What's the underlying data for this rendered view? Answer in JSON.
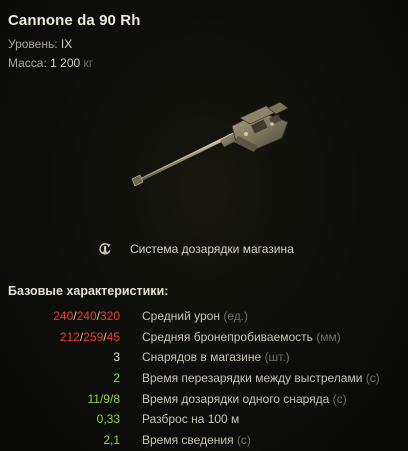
{
  "module": {
    "name": "Cannone da 90 Rh",
    "level_label": "Уровень:",
    "level_value": "IX",
    "mass_label": "Масса:",
    "mass_value": "1 200",
    "mass_unit": "кг"
  },
  "feature": {
    "icon": "autoreloader-icon",
    "label": "Система дозарядки магазина"
  },
  "section_title": "Базовые характеристики:",
  "stats": {
    "damage": {
      "v1": "240",
      "v2": "240",
      "v3": "320",
      "label": "Средний урон",
      "unit": "(ед.)"
    },
    "penetration": {
      "v1": "212",
      "v2": "259",
      "v3": "45",
      "label": "Средняя бронепробиваемость",
      "unit": "(мм)"
    },
    "magazine": {
      "value": "3",
      "label": "Снарядов в магазине",
      "unit": "(шт.)"
    },
    "interclip": {
      "value": "2",
      "label": "Время перезарядки между выстрелами",
      "unit": "(с)"
    },
    "shell_reload": {
      "value": "11/9/8",
      "label": "Время дозарядки одного снаряда",
      "unit": "(с)"
    },
    "dispersion": {
      "value": "0,33",
      "label": "Разброс на 100 м",
      "unit": ""
    },
    "aim_time": {
      "value": "2,1",
      "label": "Время сведения",
      "unit": "(с)"
    }
  },
  "colors": {
    "negative": "#e8412f",
    "positive": "#8fd63f",
    "neutral": "#e5e2d2"
  }
}
